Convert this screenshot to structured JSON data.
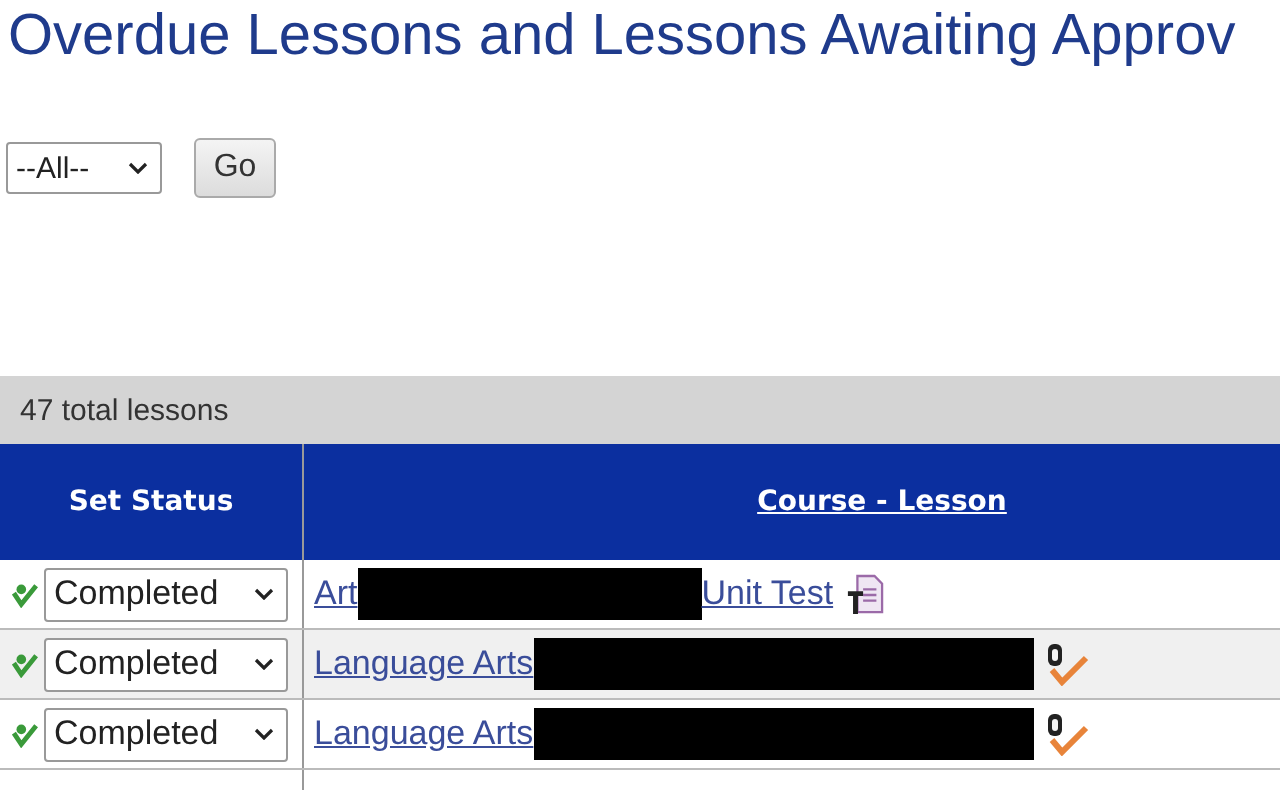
{
  "page": {
    "title": "Overdue Lessons and Lessons Awaiting Approv"
  },
  "filter": {
    "value": "--All--",
    "button": "Go"
  },
  "table": {
    "summary": "47 total lessons",
    "columns": [
      "Set Status",
      "Course - Lesson"
    ],
    "rows": [
      {
        "status": "Completed",
        "course": "Art",
        "redacted": true,
        "lesson": "Unit Test",
        "kind": "test"
      },
      {
        "status": "Completed",
        "course": "Language Arts",
        "redacted": true,
        "kind": "quiz"
      },
      {
        "status": "Completed",
        "course": "Language Arts",
        "redacted": true,
        "kind": "quiz"
      }
    ]
  }
}
